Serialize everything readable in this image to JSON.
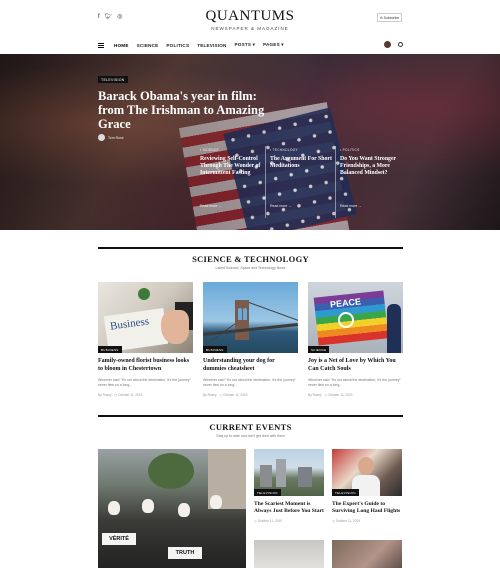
{
  "site": {
    "name": "QUANTUMS",
    "tagline": "NEWSPAPER & MAGAZINE",
    "subscribe_label": "Subscribe",
    "social_icons": [
      "facebook-icon",
      "twitter-icon",
      "instagram-icon"
    ]
  },
  "nav": {
    "items": [
      "HOME",
      "SCIENCE",
      "POLITICS",
      "TELEVISION",
      "POSTS ▾",
      "PAGES ▾"
    ],
    "active": "HOME"
  },
  "hero": {
    "badge": "TELEVISION",
    "title": "Barack Obama's year in film: from The Irishman to Amazing Grace",
    "author": "Tom Rose",
    "side": [
      {
        "category": "• SCIENCE",
        "title": "Reviewing Self-Control Through The Wonder of Intermittent Fasting",
        "read_more": "Read more →"
      },
      {
        "category": "• TECHNOLOGY",
        "title": "The Argument For Short Meditations",
        "read_more": "Read more →"
      },
      {
        "category": "• POLITICS",
        "title": "Do You Want Stronger Friendships, a More Balanced Mindset?",
        "read_more": "Read more →"
      }
    ]
  },
  "science_section": {
    "heading": "SCIENCE & TECHNOLOGY",
    "subheading": "Latest Science, Space and Technology News",
    "cards": [
      {
        "category": "BUSINESS",
        "image_text": "Business",
        "title": "Family-owned florist business looks to bloom in Chestertown",
        "excerpt": "Whoever said \"It's not about the destination, it's the journey\" never flew on a long...",
        "author": "By Rosey",
        "date": "October 11, 2019"
      },
      {
        "category": "BUSINESS",
        "image_text": "",
        "title": "Understanding your dog for dummies cheatsheet",
        "excerpt": "Whoever said \"It's not about the destination, it's the journey\" never flew on a long...",
        "author": "By Rosey",
        "date": "October 11, 2019"
      },
      {
        "category": "SCIENCE",
        "image_text": "PEACE",
        "title": "Joy is a Net of Love by Which You Can Catch Souls",
        "excerpt": "Whoever said \"It's not about the destination, it's the journey\" never flew on a long...",
        "author": "By Rosey",
        "date": "October 11, 2019"
      }
    ]
  },
  "events_section": {
    "heading": "CURRENT EVENTS",
    "subheading": "Stay up to date and don't get tired with them",
    "big_image_signs": [
      "VÉRITÉ",
      "TRUTH"
    ],
    "cards": [
      {
        "category": "TELEVISION",
        "title": "The Scariest Moment is Always Just Before You Start",
        "date": "October 11, 2019"
      },
      {
        "category": "TELEVISION",
        "title": "The Expert's Guide to Surviving Long Haul Flights",
        "date": "October 11, 2019"
      }
    ]
  }
}
